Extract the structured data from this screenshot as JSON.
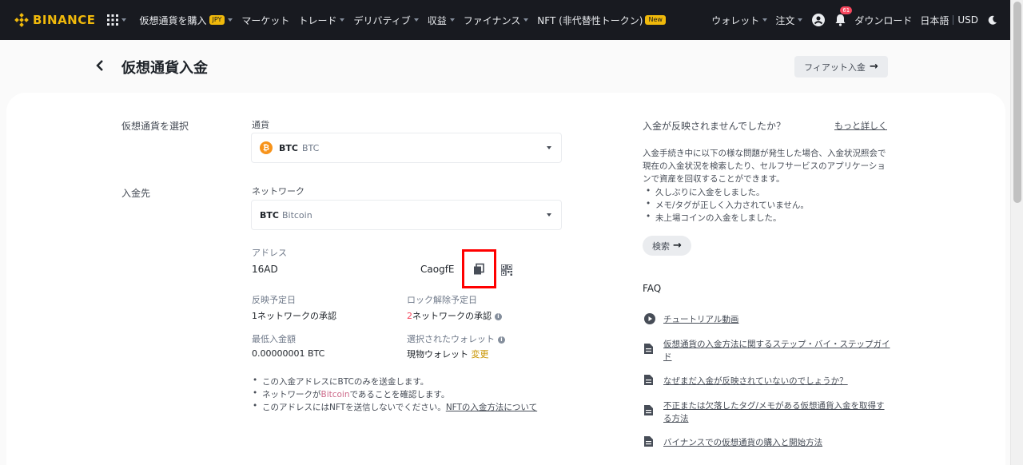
{
  "nav": {
    "logo": "BINANCE",
    "items": [
      {
        "label": "仮想通貨を購入",
        "badge": "JPY",
        "caret": true
      },
      {
        "label": "マーケット",
        "caret": false
      },
      {
        "label": "トレード",
        "caret": true
      },
      {
        "label": "デリバティブ",
        "caret": true
      },
      {
        "label": "収益",
        "caret": true
      },
      {
        "label": "ファイナンス",
        "caret": true
      },
      {
        "label": "NFT (非代替性トークン)",
        "badge": "New",
        "caret": false
      }
    ],
    "wallet": "ウォレット",
    "orders": "注文",
    "notification_count": "61",
    "download": "ダウンロード",
    "language": "日本語",
    "currency": "USD"
  },
  "header": {
    "title": "仮想通貨入金",
    "fiat_button": "フィアット入金"
  },
  "form": {
    "select_coin_label": "仮想通貨を選択",
    "currency_label": "通貨",
    "coin_symbol": "BTC",
    "coin_name": "BTC",
    "deposit_to_label": "入金先",
    "network_label": "ネットワーク",
    "network_symbol": "BTC",
    "network_name": "Bitcoin",
    "address_label": "アドレス",
    "address_start": "16AD",
    "address_end": "CaogfE",
    "expected_arrival_label": "反映予定日",
    "expected_arrival_num": "1",
    "expected_arrival_text": "ネットワークの承認",
    "unlock_label": "ロック解除予定日",
    "unlock_num": "2",
    "unlock_text": "ネットワークの承認",
    "min_deposit_label": "最低入金額",
    "min_deposit_value": "0.00000001 BTC",
    "selected_wallet_label": "選択されたウォレット",
    "selected_wallet_value": "現物ウォレット",
    "change_link": "変更",
    "note1": "この入金アドレスにBTCのみを送金します。",
    "note2_pre": "ネットワークが",
    "note2_hl": "Bitcoin",
    "note2_post": "であることを確認します。",
    "note3_pre": "このアドレスにはNFTを送信しないでください。",
    "note3_link": "NFTの入金方法について"
  },
  "help": {
    "title": "入金が反映されませんでしたか？",
    "more_link": "もっと詳しく",
    "paragraph": "入金手続き中に以下の様な問題が発生した場合、入金状況照会で現在の入金状況を検索したり、セルフサービスのアプリケーションで資産を回収することができます。",
    "bullets": [
      "久しぶりに入金をしました。",
      "メモ/タグが正しく入力されていません。",
      "未上場コインの入金をしました。"
    ],
    "search_button": "検索"
  },
  "faq": {
    "title": "FAQ",
    "items": [
      {
        "label": "チュートリアル動画",
        "icon": "play-icon"
      },
      {
        "label": "仮想通貨の入金方法に関するステップ・バイ・ステップガイド",
        "icon": "document-icon"
      },
      {
        "label": "なぜまだ入金が反映されていないのでしょうか？",
        "icon": "document-icon"
      },
      {
        "label": "不正または欠落したタグ/メモがある仮想通貨入金を取得する方法",
        "icon": "document-icon"
      },
      {
        "label": "バイナンスでの仮想通貨の購入と開始方法",
        "icon": "document-icon"
      }
    ]
  },
  "colors": {
    "nav_bg": "#181a20",
    "brand": "#f0b90b",
    "highlight_box": "#ff0000",
    "bitcoin": "#f7931a"
  }
}
